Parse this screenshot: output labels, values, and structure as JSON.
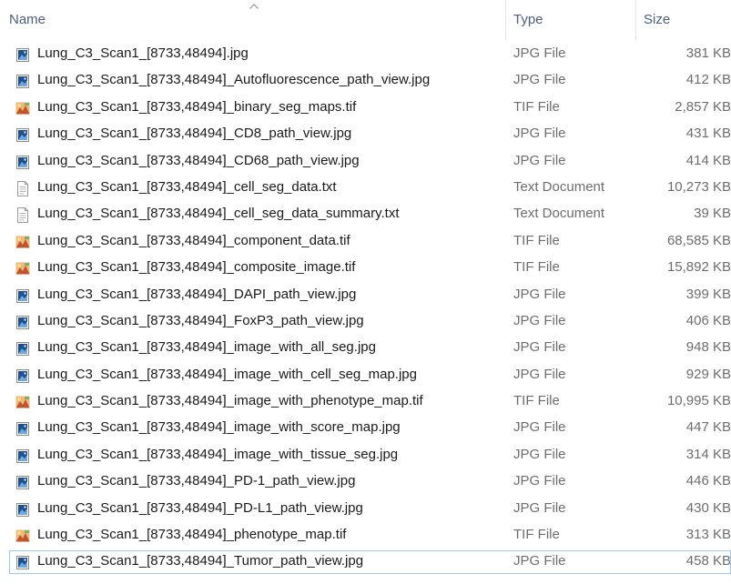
{
  "columns": {
    "name": "Name",
    "type": "Type",
    "size": "Size"
  },
  "sort_icon": "chevron-up-icon",
  "files": [
    {
      "name": "Lung_C3_Scan1_[8733,48494].jpg",
      "type": "JPG File",
      "size": "381 KB",
      "icon": "jpg-file-icon"
    },
    {
      "name": "Lung_C3_Scan1_[8733,48494]_Autofluorescence_path_view.jpg",
      "type": "JPG File",
      "size": "412 KB",
      "icon": "jpg-file-icon"
    },
    {
      "name": "Lung_C3_Scan1_[8733,48494]_binary_seg_maps.tif",
      "type": "TIF File",
      "size": "2,857 KB",
      "icon": "tif-file-icon"
    },
    {
      "name": "Lung_C3_Scan1_[8733,48494]_CD8_path_view.jpg",
      "type": "JPG File",
      "size": "431 KB",
      "icon": "jpg-file-icon"
    },
    {
      "name": "Lung_C3_Scan1_[8733,48494]_CD68_path_view.jpg",
      "type": "JPG File",
      "size": "414 KB",
      "icon": "jpg-file-icon"
    },
    {
      "name": "Lung_C3_Scan1_[8733,48494]_cell_seg_data.txt",
      "type": "Text Document",
      "size": "10,273 KB",
      "icon": "text-file-icon"
    },
    {
      "name": "Lung_C3_Scan1_[8733,48494]_cell_seg_data_summary.txt",
      "type": "Text Document",
      "size": "39 KB",
      "icon": "text-file-icon"
    },
    {
      "name": "Lung_C3_Scan1_[8733,48494]_component_data.tif",
      "type": "TIF File",
      "size": "68,585 KB",
      "icon": "tif-file-icon"
    },
    {
      "name": "Lung_C3_Scan1_[8733,48494]_composite_image.tif",
      "type": "TIF File",
      "size": "15,892 KB",
      "icon": "tif-file-icon"
    },
    {
      "name": "Lung_C3_Scan1_[8733,48494]_DAPI_path_view.jpg",
      "type": "JPG File",
      "size": "399 KB",
      "icon": "jpg-file-icon"
    },
    {
      "name": "Lung_C3_Scan1_[8733,48494]_FoxP3_path_view.jpg",
      "type": "JPG File",
      "size": "406 KB",
      "icon": "jpg-file-icon"
    },
    {
      "name": "Lung_C3_Scan1_[8733,48494]_image_with_all_seg.jpg",
      "type": "JPG File",
      "size": "948 KB",
      "icon": "jpg-file-icon"
    },
    {
      "name": "Lung_C3_Scan1_[8733,48494]_image_with_cell_seg_map.jpg",
      "type": "JPG File",
      "size": "929 KB",
      "icon": "jpg-file-icon"
    },
    {
      "name": "Lung_C3_Scan1_[8733,48494]_image_with_phenotype_map.tif",
      "type": "TIF File",
      "size": "10,995 KB",
      "icon": "tif-file-icon"
    },
    {
      "name": "Lung_C3_Scan1_[8733,48494]_image_with_score_map.jpg",
      "type": "JPG File",
      "size": "447 KB",
      "icon": "jpg-file-icon"
    },
    {
      "name": "Lung_C3_Scan1_[8733,48494]_image_with_tissue_seg.jpg",
      "type": "JPG File",
      "size": "314 KB",
      "icon": "jpg-file-icon"
    },
    {
      "name": "Lung_C3_Scan1_[8733,48494]_PD-1_path_view.jpg",
      "type": "JPG File",
      "size": "446 KB",
      "icon": "jpg-file-icon"
    },
    {
      "name": "Lung_C3_Scan1_[8733,48494]_PD-L1_path_view.jpg",
      "type": "JPG File",
      "size": "430 KB",
      "icon": "jpg-file-icon"
    },
    {
      "name": "Lung_C3_Scan1_[8733,48494]_phenotype_map.tif",
      "type": "TIF File",
      "size": "313 KB",
      "icon": "tif-file-icon"
    },
    {
      "name": "Lung_C3_Scan1_[8733,48494]_Tumor_path_view.jpg",
      "type": "JPG File",
      "size": "458 KB",
      "icon": "jpg-file-icon",
      "focused": true
    }
  ]
}
